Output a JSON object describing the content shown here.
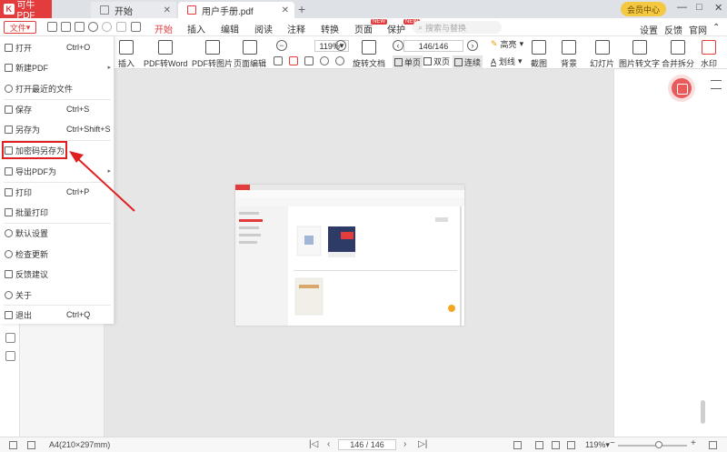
{
  "titlebar": {
    "app_name": "可牛PDF",
    "tabs": [
      {
        "label": "开始"
      },
      {
        "label": "用户手册.pdf"
      }
    ],
    "vip_label": "会员中心",
    "controls": [
      "—",
      "□",
      "✕"
    ]
  },
  "menubar": {
    "file_label": "文件",
    "tabs": [
      {
        "label": "开始"
      },
      {
        "label": "插入"
      },
      {
        "label": "编辑"
      },
      {
        "label": "阅读"
      },
      {
        "label": "注释"
      },
      {
        "label": "转换"
      },
      {
        "label": "页面"
      },
      {
        "label": "保护"
      }
    ],
    "new_badge": "NEW",
    "search_placeholder": "搜索与替换",
    "right_links": [
      "设置",
      "反馈",
      "官网"
    ]
  },
  "toolbar": {
    "zoom": "119%",
    "page": "146/146",
    "buttons": {
      "insert": "插入",
      "pdf_to_word": "PDF转Word",
      "pdf_to_image": "PDF转图片",
      "page_edit": "页面编辑",
      "rotate": "旋转文档",
      "highlight": "高亮",
      "underline": "划线",
      "screenshot": "截图",
      "background": "背景",
      "slideshow": "幻灯片",
      "image_to_text": "图片转文字",
      "merge_split": "合并拆分",
      "watermark": "水印"
    },
    "view_modes": {
      "single": "单页",
      "double": "双页",
      "continuous": "连续"
    }
  },
  "file_menu": {
    "items": [
      {
        "label": "打开",
        "shortcut": "Ctrl+O"
      },
      {
        "label": "新建PDF",
        "shortcut": ""
      },
      {
        "label": "打开最近的文件",
        "shortcut": ""
      },
      {
        "label": "保存",
        "shortcut": "Ctrl+S"
      },
      {
        "label": "另存为",
        "shortcut": "Ctrl+Shift+S"
      },
      {
        "label": "加密码另存为",
        "shortcut": ""
      },
      {
        "label": "导出PDF为",
        "shortcut": ""
      },
      {
        "label": "打印",
        "shortcut": "Ctrl+P"
      },
      {
        "label": "批量打印",
        "shortcut": ""
      },
      {
        "label": "默认设置",
        "shortcut": ""
      },
      {
        "label": "检查更新",
        "shortcut": ""
      },
      {
        "label": "反馈建议",
        "shortcut": ""
      },
      {
        "label": "关于",
        "shortcut": ""
      },
      {
        "label": "退出",
        "shortcut": "Ctrl+Q"
      }
    ]
  },
  "statusbar": {
    "page_size": "A4(210×297mm)",
    "page_indicator": "146 / 146",
    "zoom": "119%"
  },
  "colors": {
    "accent": "#e23c3c",
    "highlight_box": "#e02020"
  }
}
